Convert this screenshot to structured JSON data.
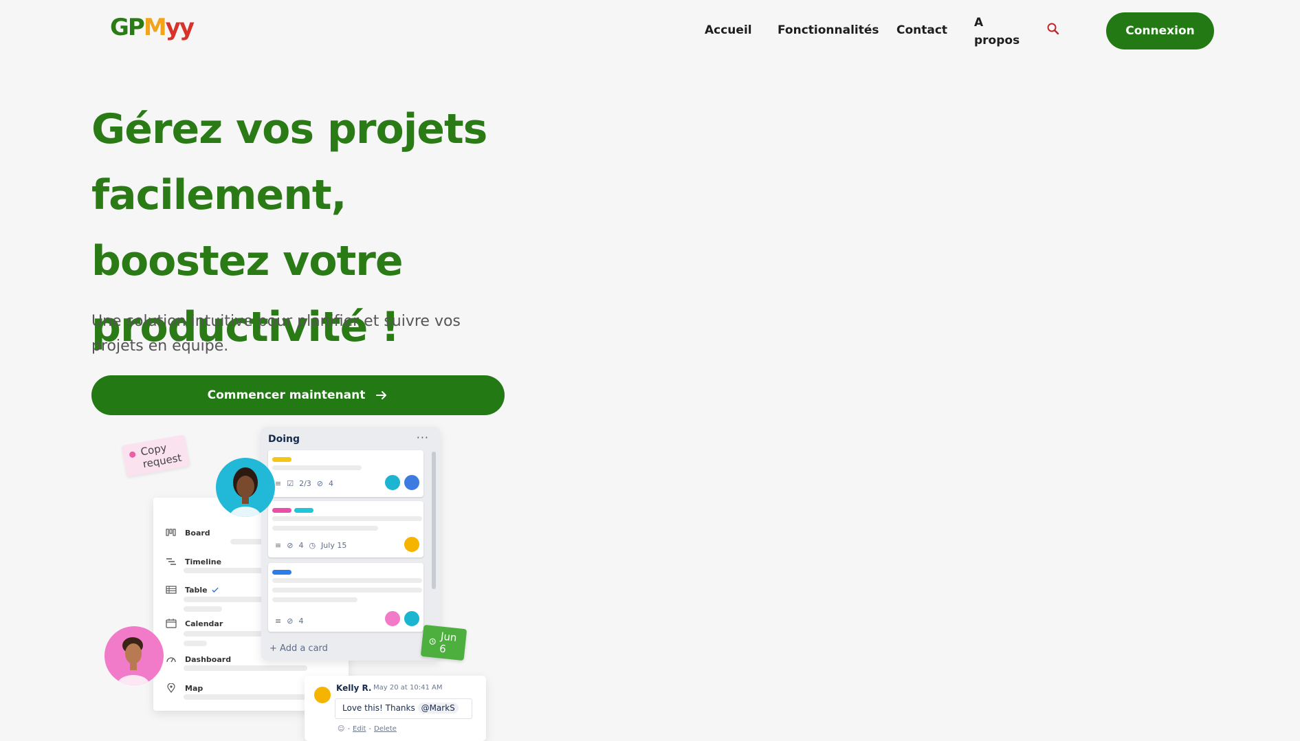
{
  "brand": {
    "logo_part1": "GP",
    "logo_part2": "M",
    "logo_part3": "yy",
    "colors": {
      "green": "#2a7a16",
      "orange": "#f2a41a",
      "red": "#d8322a",
      "button_green": "#237a14"
    }
  },
  "nav": {
    "home": "Accueil",
    "features": "Fonctionnalités",
    "contact": "Contact",
    "about": "A propos",
    "search_icon": "search-icon",
    "login": "Connexion"
  },
  "hero": {
    "title": "Gérez vos projets facilement, boostez votre productivité !",
    "subtitle": "Une solution intuitive pour planifier et suivre vos projets en équipe.",
    "cta": "Commencer maintenant"
  },
  "illustration": {
    "copy_tag": "Copy request",
    "sidebar": [
      "Board",
      "Timeline",
      "Table",
      "Calendar",
      "Dashboard",
      "Map"
    ],
    "column_title": "Doing",
    "column_menu": "···",
    "card1": {
      "checklist": "2/3",
      "attachments": "4"
    },
    "card2": {
      "attachments": "4",
      "due": "July 15"
    },
    "card3": {
      "attachments": "4"
    },
    "add_card": "+ Add a card",
    "date_tag": "Jun 6",
    "comment": {
      "author": "Kelly R.",
      "time": "May 20 at 10:41 AM",
      "text": "Love this! Thanks",
      "mention": "@MarkS",
      "edit": "Edit",
      "delete": "Delete"
    }
  }
}
